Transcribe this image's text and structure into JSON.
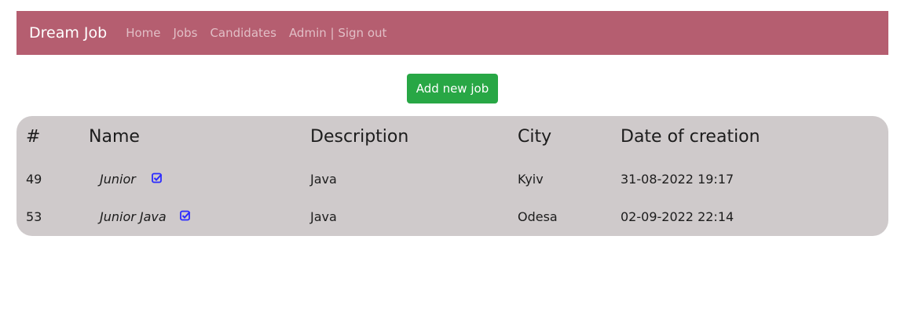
{
  "navbar": {
    "brand": "Dream Job",
    "links": [
      "Home",
      "Jobs",
      "Candidates",
      "Admin | Sign out"
    ]
  },
  "actions": {
    "add_job": "Add new job"
  },
  "table": {
    "headers": [
      "#",
      "Name",
      "Description",
      "City",
      "Date of creation"
    ],
    "rows": [
      {
        "id": "49",
        "name": "Junior",
        "checked": true,
        "description": "Java",
        "city": "Kyiv",
        "date": "31-08-2022 19:17"
      },
      {
        "id": "53",
        "name": "Junior Java",
        "checked": true,
        "description": "Java",
        "city": "Odesa",
        "date": "02-09-2022 22:14"
      }
    ]
  },
  "colors": {
    "navbar": "#b55e70",
    "button": "#28a745",
    "table_bg": "#cfcacb",
    "check": "#2b2bff"
  },
  "icons": {
    "check": "check-square-icon"
  }
}
